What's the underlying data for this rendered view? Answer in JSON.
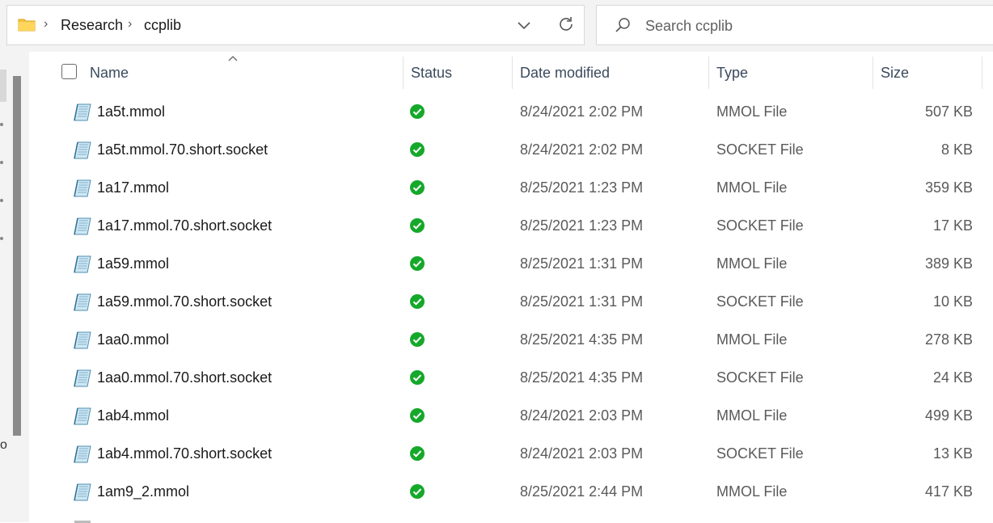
{
  "address": {
    "breadcrumbs": [
      "Research",
      "ccplib"
    ],
    "separator": "›"
  },
  "search": {
    "placeholder": "Search ccplib"
  },
  "leftpane": {
    "partial_char": "o"
  },
  "columns": {
    "name": "Name",
    "status": "Status",
    "date_modified": "Date modified",
    "type": "Type",
    "size": "Size"
  },
  "files": [
    {
      "name": "1a5t.mmol",
      "date": "8/24/2021 2:02 PM",
      "type": "MMOL File",
      "size": "507 KB"
    },
    {
      "name": "1a5t.mmol.70.short.socket",
      "date": "8/24/2021 2:02 PM",
      "type": "SOCKET File",
      "size": "8 KB"
    },
    {
      "name": "1a17.mmol",
      "date": "8/25/2021 1:23 PM",
      "type": "MMOL File",
      "size": "359 KB"
    },
    {
      "name": "1a17.mmol.70.short.socket",
      "date": "8/25/2021 1:23 PM",
      "type": "SOCKET File",
      "size": "17 KB"
    },
    {
      "name": "1a59.mmol",
      "date": "8/25/2021 1:31 PM",
      "type": "MMOL File",
      "size": "389 KB"
    },
    {
      "name": "1a59.mmol.70.short.socket",
      "date": "8/25/2021 1:31 PM",
      "type": "SOCKET File",
      "size": "10 KB"
    },
    {
      "name": "1aa0.mmol",
      "date": "8/25/2021 4:35 PM",
      "type": "MMOL File",
      "size": "278 KB"
    },
    {
      "name": "1aa0.mmol.70.short.socket",
      "date": "8/25/2021 4:35 PM",
      "type": "SOCKET File",
      "size": "24 KB"
    },
    {
      "name": "1ab4.mmol",
      "date": "8/24/2021 2:03 PM",
      "type": "MMOL File",
      "size": "499 KB"
    },
    {
      "name": "1ab4.mmol.70.short.socket",
      "date": "8/24/2021 2:03 PM",
      "type": "SOCKET File",
      "size": "13 KB"
    },
    {
      "name": "1am9_2.mmol",
      "date": "8/25/2021 2:44 PM",
      "type": "MMOL File",
      "size": "417 KB"
    }
  ],
  "icons": {
    "folder": "folder-icon",
    "file": "file-icon",
    "status": "synced-checkmark-icon",
    "search": "search-icon",
    "refresh": "refresh-icon"
  },
  "colors": {
    "status_green": "#15a82a",
    "folder_yellow": "#f5c342",
    "header_text": "#3b4a5c"
  }
}
